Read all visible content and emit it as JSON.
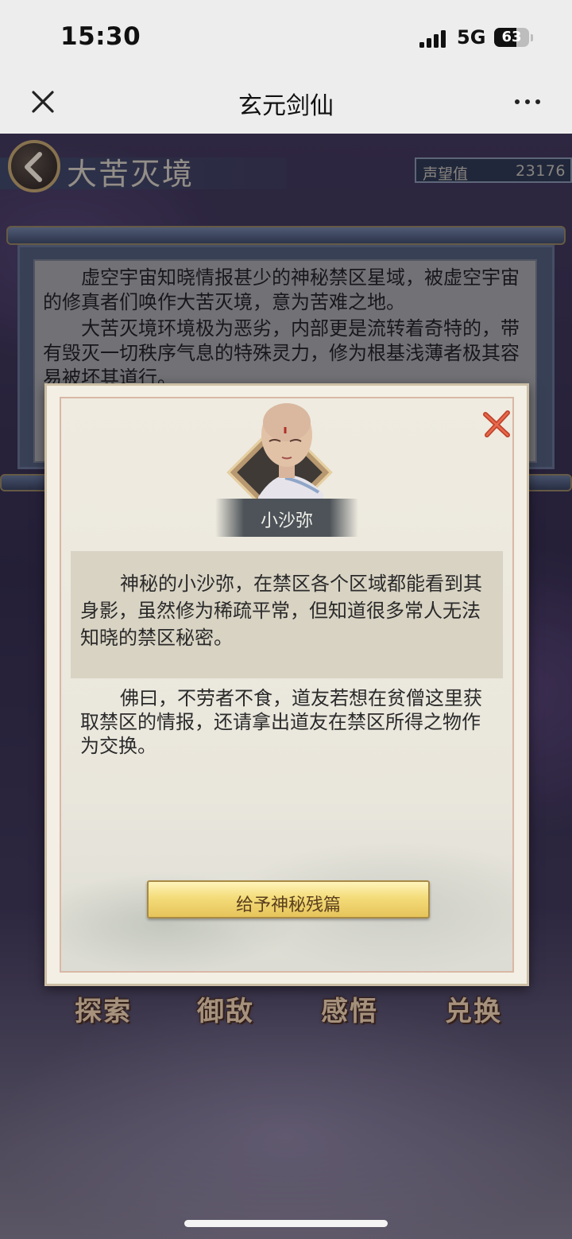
{
  "status_bar": {
    "time": "15:30",
    "network": "5G",
    "battery": "63"
  },
  "title_bar": {
    "title": "玄元剑仙",
    "close_icon": "close-icon",
    "more_icon": "more-icon"
  },
  "game": {
    "region_title": "大苦灭境",
    "reputation_label": "声望值",
    "reputation_value": "23176",
    "intro_paragraphs": [
      "虚空宇宙知晓情报甚少的神秘禁区星域，被虚空宇宙的修真者们唤作大苦灭境，意为苦难之地。",
      "大苦灭境环境极为恶劣，内部更是流转着奇特的，带有毁灭一切秩序气息的特殊灵力，修为根基浅薄者极其容易被坏其道行。"
    ],
    "nav": [
      "探索",
      "御敌",
      "感悟",
      "兑换"
    ]
  },
  "dialog": {
    "npc_name": "小沙弥",
    "description": "神秘的小沙弥，在禁区各个区域都能看到其身影，虽然修为稀疏平常，但知道很多常人无法知晓的禁区秘密。",
    "speech": "佛曰，不劳者不食，道友若想在贫僧这里获取禁区的情报，还请拿出道友在禁区所得之物作为交换。",
    "action_button": "给予神秘残篇"
  }
}
